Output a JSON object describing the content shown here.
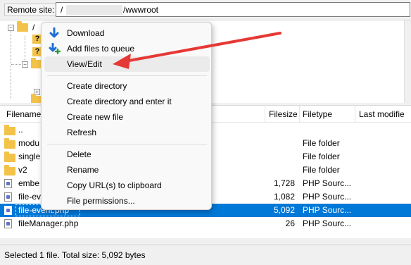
{
  "remote_bar": {
    "label": "Remote site:",
    "path_start": "/",
    "path_end": "/wwwroot"
  },
  "tree": {
    "root_label": "/",
    "question_mark": "?"
  },
  "list": {
    "headers": {
      "filename": "Filename",
      "filesize": "Filesize",
      "filetype": "Filetype",
      "last_modified": "Last modifie"
    },
    "rows": [
      {
        "name": "..",
        "size": "",
        "type": "",
        "icon": "folder-icon"
      },
      {
        "name": "modu",
        "size": "",
        "type": "File folder",
        "icon": "folder-icon"
      },
      {
        "name": "single",
        "size": "",
        "type": "File folder",
        "icon": "folder-icon"
      },
      {
        "name": "v2",
        "size": "",
        "type": "File folder",
        "icon": "folder-icon"
      },
      {
        "name": "embe",
        "size": "1,728",
        "type": "PHP Sourc...",
        "icon": "php-file-icon"
      },
      {
        "name": "file-eve",
        "size": "1,082",
        "type": "PHP Sourc...",
        "icon": "php-file-icon"
      },
      {
        "name": "file-event.php",
        "size": "5,092",
        "type": "PHP Sourc...",
        "icon": "php-file-icon"
      },
      {
        "name": "fileManager.php",
        "size": "26",
        "type": "PHP Sourc...",
        "icon": "php-file-icon"
      }
    ]
  },
  "status": {
    "text": "Selected 1 file. Total size: 5,092 bytes"
  },
  "context_menu": {
    "items": [
      {
        "label": "Download",
        "icon": "download-arrow-icon"
      },
      {
        "label": "Add files to queue",
        "icon": "add-to-queue-icon"
      },
      {
        "label": "View/Edit",
        "icon": ""
      },
      {
        "label": "Create directory",
        "icon": ""
      },
      {
        "label": "Create directory and enter it",
        "icon": ""
      },
      {
        "label": "Create new file",
        "icon": ""
      },
      {
        "label": "Refresh",
        "icon": ""
      },
      {
        "label": "Delete",
        "icon": ""
      },
      {
        "label": "Rename",
        "icon": ""
      },
      {
        "label": "Copy URL(s) to clipboard",
        "icon": ""
      },
      {
        "label": "File permissions...",
        "icon": ""
      }
    ]
  },
  "colors": {
    "selection": "#0078d7",
    "annotation_arrow": "#e53935",
    "folder": "#f3c248"
  }
}
